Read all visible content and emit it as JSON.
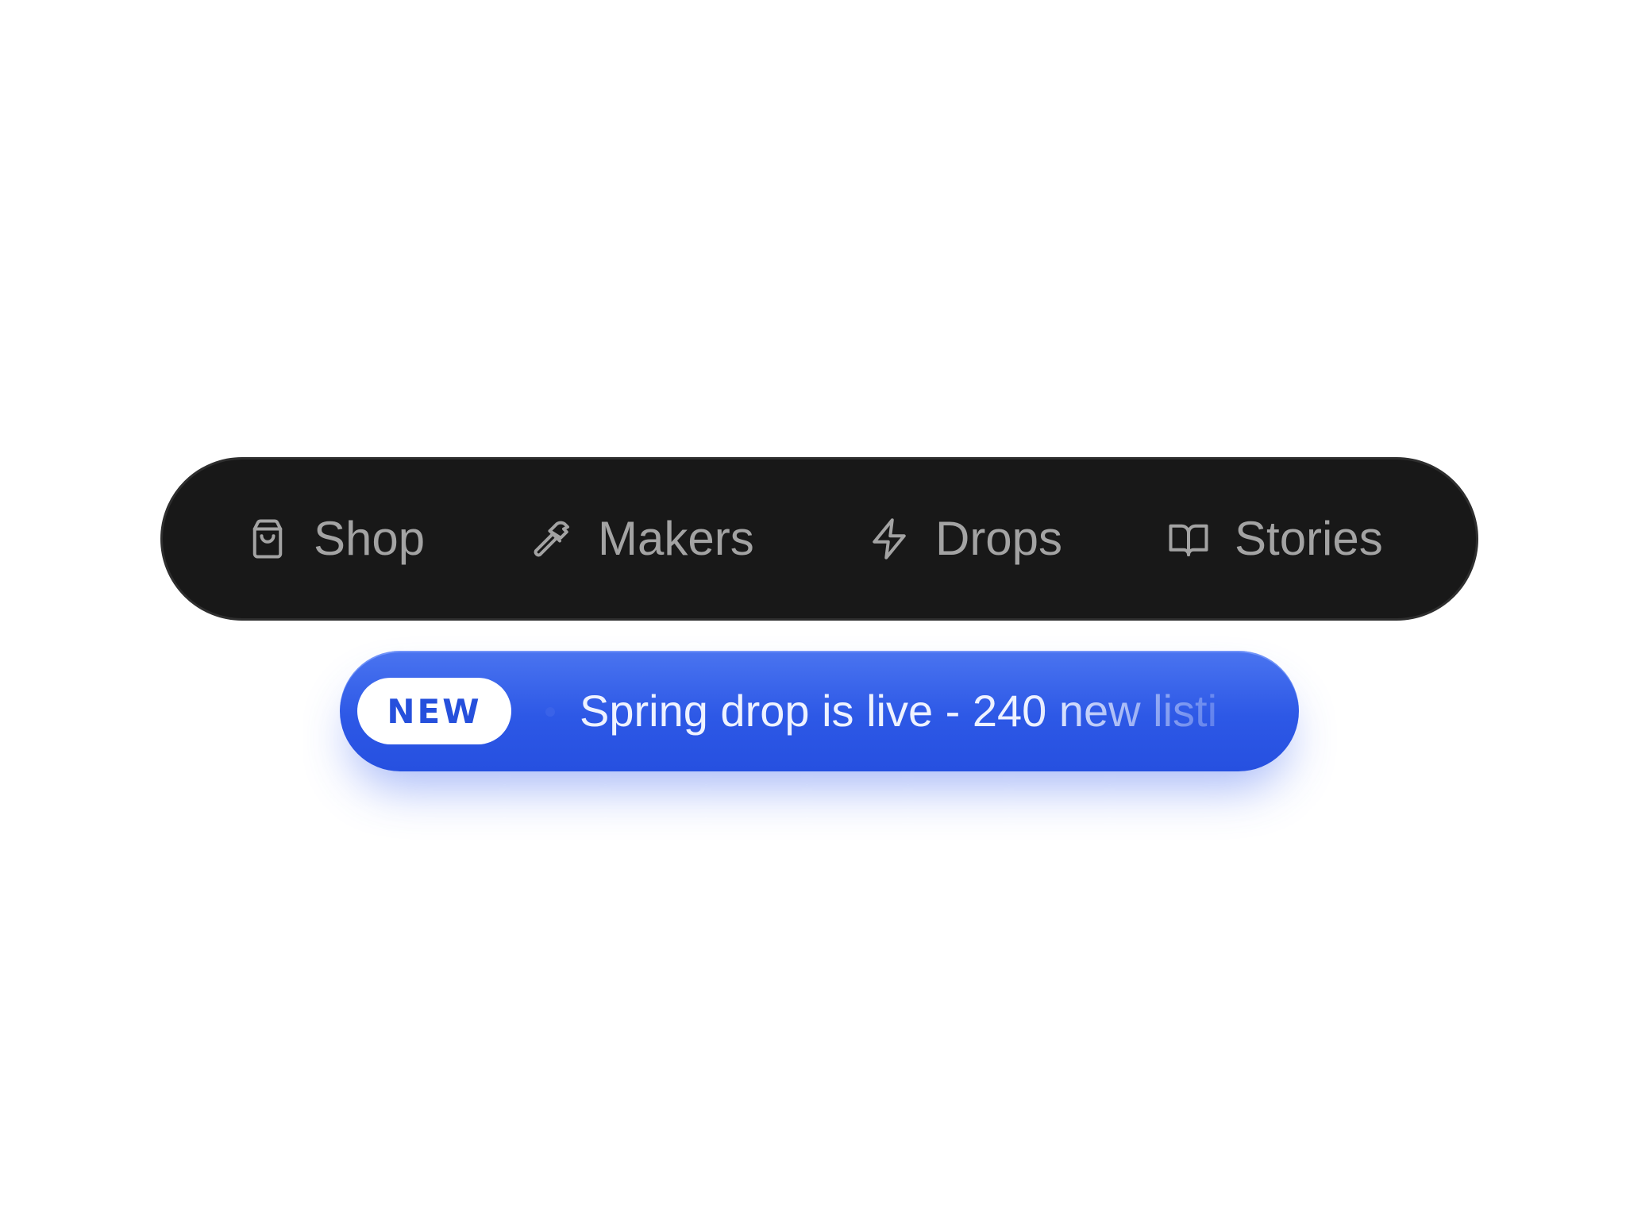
{
  "nav": {
    "items": [
      {
        "label": "Shop",
        "icon": "shopping-bag-icon"
      },
      {
        "label": "Makers",
        "icon": "hammer-icon"
      },
      {
        "label": "Drops",
        "icon": "lightning-bolt-icon"
      },
      {
        "label": "Stories",
        "icon": "open-book-icon"
      }
    ]
  },
  "announcement": {
    "badge": "NEW",
    "message": "Spring drop is live - 240 new listi"
  },
  "colors": {
    "nav_background": "#181818",
    "nav_text": "#a3a3a3",
    "banner_blue": "#2d58e6",
    "badge_text": "#2650dc",
    "page_background": "#ffffff"
  }
}
